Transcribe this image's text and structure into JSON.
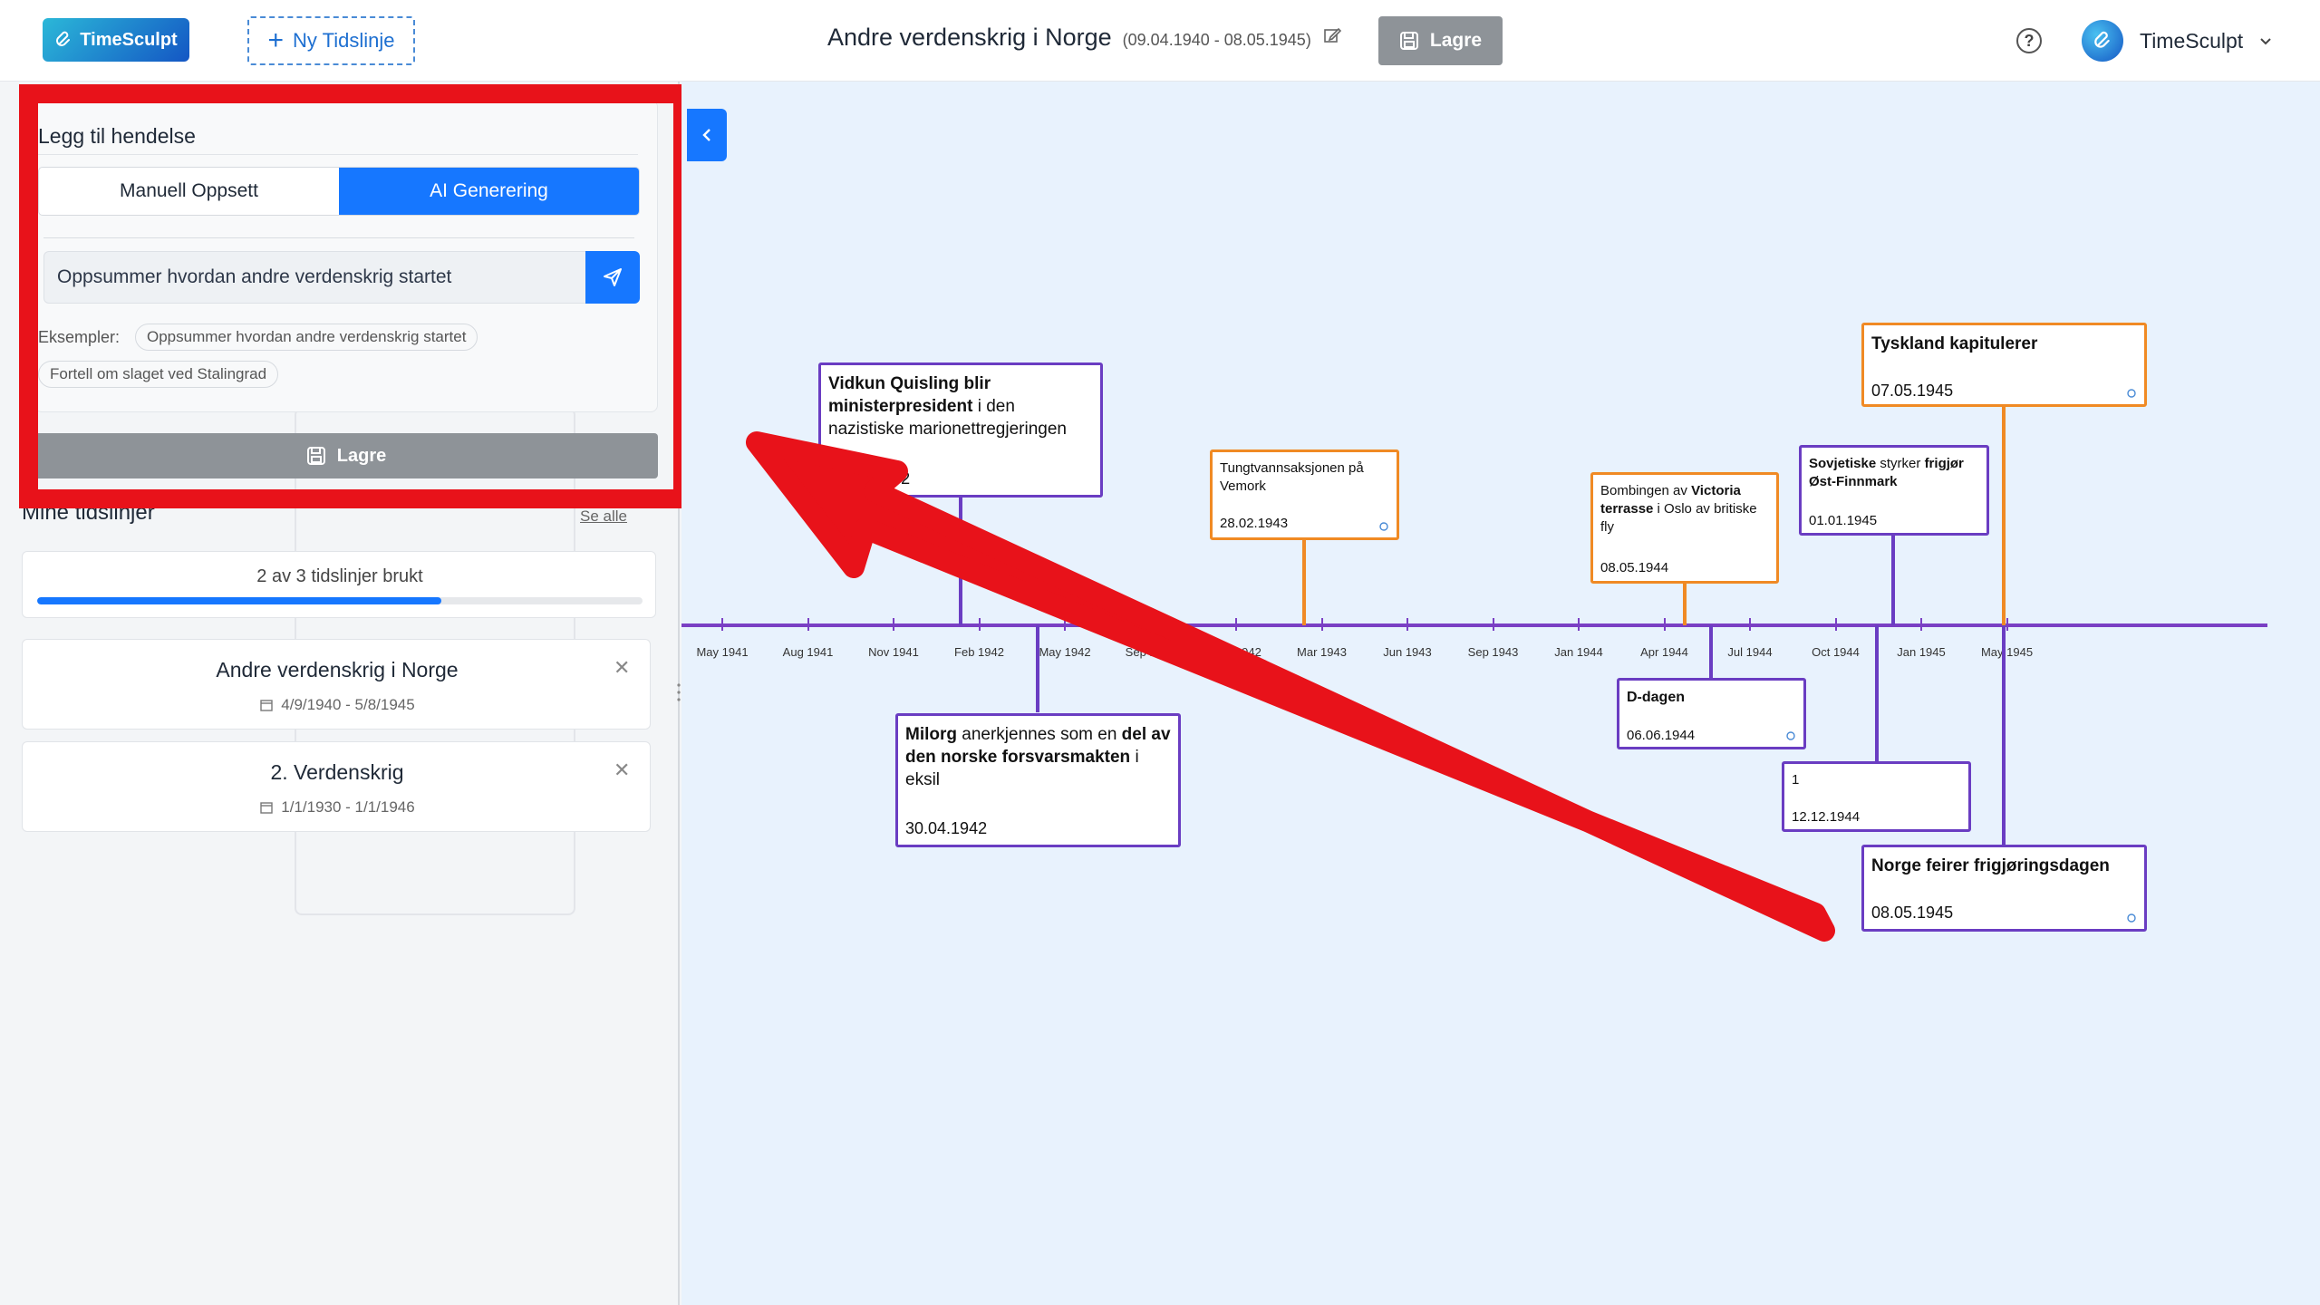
{
  "header": {
    "logo": "TimeSculpt",
    "new_timeline": "Ny Tidslinje",
    "title": "Andre verdenskrig i Norge",
    "date_range": "(09.04.1940 - 08.05.1945)",
    "save": "Lagre",
    "user": "TimeSculpt"
  },
  "add_event": {
    "title": "Legg til hendelse",
    "tabs": [
      "Manuell Oppsett",
      "AI Generering"
    ],
    "active_tab": "AI Generering",
    "prompt_value": "Oppsummer hvordan andre verdenskrig startet",
    "examples_label": "Eksempler:",
    "examples": [
      "Oppsummer hvordan andre verdenskrig startet",
      "Fortell om slaget ved Stalingrad"
    ],
    "save": "Lagre"
  },
  "sidebar": {
    "my_timelines": "Mine tidslinjer",
    "see_all": "Se alle",
    "usage_label": "2 av 3 tidslinjer brukt",
    "usage_fraction": 0.667,
    "timelines": [
      {
        "title": "Andre verdenskrig i Norge",
        "dates": "4/9/1940 - 5/8/1945"
      },
      {
        "title": "2. Verdenskrig",
        "dates": "1/1/1930 - 1/1/1946"
      }
    ]
  },
  "axis": {
    "ticks": [
      "May 1941",
      "Aug 1941",
      "Nov 1941",
      "Feb 1942",
      "May 1942",
      "Sep 1942",
      "Dec 1942",
      "Mar 1943",
      "Jun 1943",
      "Sep 1943",
      "Jan 1944",
      "Apr 1944",
      "Jul 1944",
      "Oct 1944",
      "Jan 1945",
      "May 1945"
    ]
  },
  "events": [
    {
      "id": "quisling",
      "title_html": "<b>Vidkun Quisling blir ministerpresident</b> i den nazistiske marionettregjeringen",
      "date": "01.02.1942",
      "color": "#6a3dc2"
    },
    {
      "id": "milorg",
      "title_html": "<b>Milorg</b> anerkjennes som en <b>del av den norske forsvarsmakten</b> i eksil",
      "date": "30.04.1942",
      "color": "#6a3dc2"
    },
    {
      "id": "vemork",
      "title_html": "Tungtvannsaksjonen på Vemork",
      "date": "28.02.1943",
      "color": "#f08a24"
    },
    {
      "id": "victoria",
      "title_html": "Bombingen av <b>Victoria terrasse</b> i Oslo av britiske fly",
      "date": "08.05.1944",
      "color": "#f08a24"
    },
    {
      "id": "ddagen",
      "title_html": "<b>D-dagen</b>",
      "date": "06.06.1944",
      "color": "#6a3dc2"
    },
    {
      "id": "one",
      "title_html": "1",
      "date": "12.12.1944",
      "color": "#6a3dc2"
    },
    {
      "id": "sovjet",
      "title_html": "<b>Sovjetiske</b> styrker <b>frigjør Øst-Finnmark</b>",
      "date": "01.01.1945",
      "color": "#6a3dc2"
    },
    {
      "id": "kapitulerer",
      "title_html": "<b>Tyskland kapitulerer</b>",
      "date": "07.05.1945",
      "color": "#f08a24"
    },
    {
      "id": "frigjoring",
      "title_html": "<b>Norge feirer frigjøringsdagen</b>",
      "date": "08.05.1945",
      "color": "#6a3dc2"
    }
  ],
  "colors": {
    "accent": "#1677ff",
    "axis": "#7a3fc4",
    "highlight": "#e8121a",
    "orange": "#f08a24"
  }
}
